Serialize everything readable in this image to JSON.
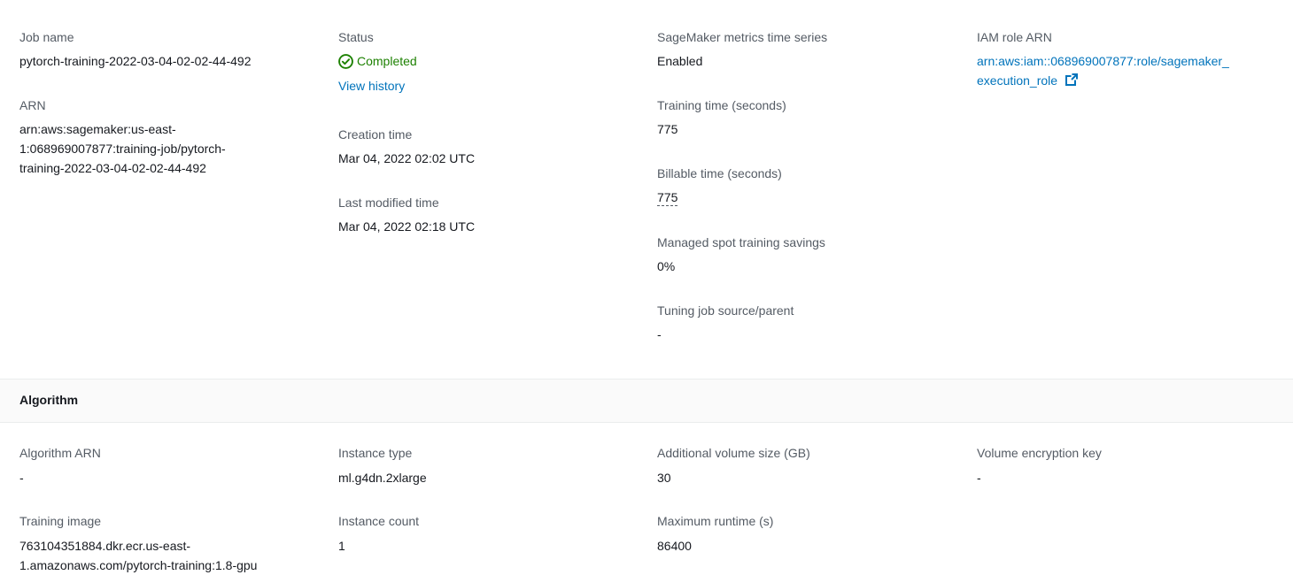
{
  "summary": {
    "job_name": {
      "label": "Job name",
      "value": "pytorch-training-2022-03-04-02-02-44-492"
    },
    "arn": {
      "label": "ARN",
      "lines": [
        "arn:aws:sagemaker:us-east-",
        "1:068969007877:training-job/pytorch-",
        "training-2022-03-04-02-02-44-492"
      ]
    },
    "status": {
      "label": "Status",
      "value": "Completed",
      "history_link": "View history"
    },
    "creation_time": {
      "label": "Creation time",
      "value": "Mar 04, 2022 02:02 UTC"
    },
    "last_modified_time": {
      "label": "Last modified time",
      "value": "Mar 04, 2022 02:18 UTC"
    },
    "metrics_time_series": {
      "label": "SageMaker metrics time series",
      "value": "Enabled"
    },
    "training_time": {
      "label": "Training time (seconds)",
      "value": "775"
    },
    "billable_time": {
      "label": "Billable time (seconds)",
      "value": "775"
    },
    "spot_savings": {
      "label": "Managed spot training savings",
      "value": "0%"
    },
    "tuning_job": {
      "label": "Tuning job source/parent",
      "value": "-"
    },
    "iam_role": {
      "label": "IAM role ARN",
      "line1": "arn:aws:iam::068969007877:role/sagemaker_",
      "line2": "execution_role"
    }
  },
  "algorithm": {
    "title": "Algorithm",
    "algorithm_arn": {
      "label": "Algorithm ARN",
      "value": "-"
    },
    "instance_type": {
      "label": "Instance type",
      "value": "ml.g4dn.2xlarge"
    },
    "volume_size": {
      "label": "Additional volume size (GB)",
      "value": "30"
    },
    "encryption_key": {
      "label": "Volume encryption key",
      "value": "-"
    },
    "training_image": {
      "label": "Training image",
      "line1": "763104351884.dkr.ecr.us-east-",
      "line2": "1.amazonaws.com/pytorch-training:1.8-gpu"
    },
    "instance_count": {
      "label": "Instance count",
      "value": "1"
    },
    "max_runtime": {
      "label": "Maximum runtime (s)",
      "value": "86400"
    }
  },
  "colors": {
    "link": "#0073bb",
    "success": "#1d8102",
    "label": "#545b64",
    "text": "#16191f"
  }
}
